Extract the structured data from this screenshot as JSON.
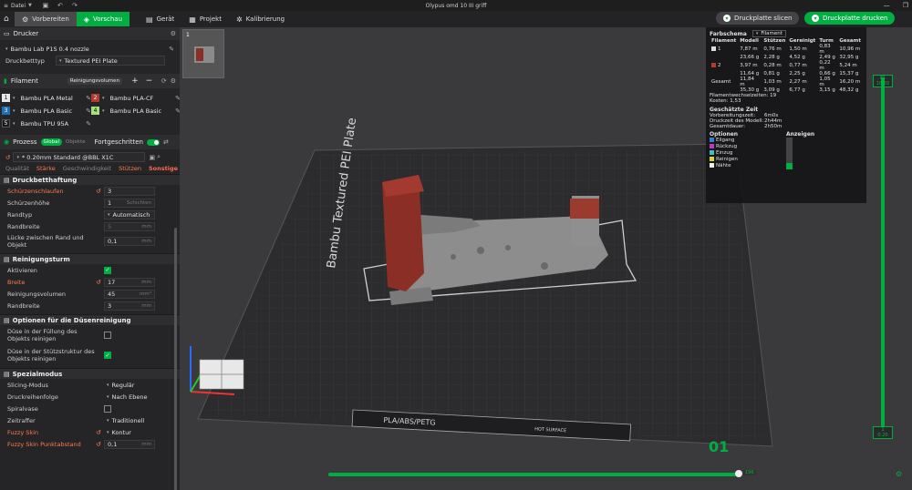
{
  "titlebar": {
    "menu": "Datei",
    "title": "Olypus omd 10 III griff"
  },
  "topbar": {
    "tabs": [
      {
        "label": "Vorbereiten"
      },
      {
        "label": "Vorschau"
      },
      {
        "label": "Gerät"
      },
      {
        "label": "Projekt"
      },
      {
        "label": "Kalibrierung"
      }
    ],
    "slice_button": "Druckplatte slicen",
    "print_button": "Druckplatte drucken"
  },
  "printer": {
    "section": "Drucker",
    "name": "Bambu Lab P1S 0.4 nozzle",
    "bed_label": "Druckbetttyp",
    "bed_value": "Textured PEI Plate"
  },
  "filament": {
    "section": "Filament",
    "clean_button": "Reinigungsvolumen",
    "items": [
      {
        "num": "1",
        "name": "Bambu PLA Metal",
        "color": "#e8e8e8"
      },
      {
        "num": "2",
        "name": "Bambu PLA-CF",
        "color": "#b23a2e"
      },
      {
        "num": "3",
        "name": "Bambu PLA Basic",
        "color": "#1f6fb2"
      },
      {
        "num": "4",
        "name": "Bambu PLA Basic",
        "color": "#a6e07a"
      },
      {
        "num": "5",
        "name": "Bambu TPU 95A",
        "color": "#1a1a1a"
      }
    ]
  },
  "process": {
    "section": "Prozess",
    "toggle_global": "Global",
    "toggle_objects": "Objekte",
    "advanced": "Fortgeschritten",
    "preset": "* 0.20mm Standard @BBL X1C",
    "tabs": [
      "Qualität",
      "Stärke",
      "Geschwindigkeit",
      "Stützen",
      "Sonstige"
    ]
  },
  "groups": [
    {
      "title": "Druckbetthaftung",
      "rows": [
        {
          "label": "Schürzenschlaufen",
          "value": "3",
          "unit": "",
          "orange": true
        },
        {
          "label": "Schürzenhöhe",
          "value": "1",
          "unit": "Schichten",
          "orange": false
        },
        {
          "label": "Randtyp",
          "value": "Automatisch",
          "unit": "",
          "orange": false,
          "drop": true
        },
        {
          "label": "Randbreite",
          "value": "5",
          "unit": "mm",
          "orange": false,
          "disabled": true
        },
        {
          "label": "Lücke zwischen Rand und Objekt",
          "value": "0,1",
          "unit": "mm",
          "orange": false
        }
      ]
    },
    {
      "title": "Reinigungsturm",
      "rows": [
        {
          "label": "Aktivieren",
          "check": true
        },
        {
          "label": "Breite",
          "value": "17",
          "unit": "mm",
          "orange": true
        },
        {
          "label": "Reinigungsvolumen",
          "value": "45",
          "unit": "mm³",
          "orange": false
        },
        {
          "label": "Randbreite",
          "value": "3",
          "unit": "mm",
          "orange": false
        }
      ]
    },
    {
      "title": "Optionen für die Düsenreinigung",
      "rows": [
        {
          "label": "Düse in der Füllung des Objekts reinigen",
          "check": false
        },
        {
          "label": "Düse in der Stützstruktur des Objekts reinigen",
          "check": true
        }
      ]
    },
    {
      "title": "Spezialmodus",
      "rows": [
        {
          "label": "Slicing-Modus",
          "value": "Regulär",
          "drop": true
        },
        {
          "label": "Druckreihenfolge",
          "value": "Nach Ebene",
          "drop": true
        },
        {
          "label": "Spiralvase",
          "check": false
        },
        {
          "label": "Zeitraffer",
          "value": "Traditionell",
          "drop": true
        },
        {
          "label": "Fuzzy Skin",
          "value": "Kontur",
          "drop": true,
          "orange": true
        },
        {
          "label": "Fuzzy Skin Punktabstand",
          "value": "0,1",
          "unit": "mm",
          "orange": true
        }
      ]
    }
  ],
  "stats": {
    "title": "Farbschema",
    "scheme": "Filament",
    "headers": [
      "Filament",
      "Modell",
      "Stützen",
      "Gereinigt",
      "Turm",
      "Gesamt"
    ],
    "rows": [
      {
        "id": "1",
        "color": "#dddddd",
        "l1": [
          "7,87 m",
          "0,76 m",
          "1,50 m",
          "0,83 m",
          "10,96 m"
        ],
        "l2": [
          "23,66 g",
          "2,28 g",
          "4,52 g",
          "2,49 g",
          "32,95 g"
        ]
      },
      {
        "id": "2",
        "color": "#b23a2e",
        "l1": [
          "3,97 m",
          "0,28 m",
          "0,77 m",
          "0,22 m",
          "5,24 m"
        ],
        "l2": [
          "11,64 g",
          "0,81 g",
          "2,25 g",
          "0,66 g",
          "15,37 g"
        ]
      }
    ],
    "total_label": "Gesamt",
    "total_l1": [
      "11,84 m",
      "1,03 m",
      "2,27 m",
      "1,05 m",
      "16,20 m"
    ],
    "total_l2": [
      "35,30 g",
      "3,09 g",
      "6,77 g",
      "3,15 g",
      "48,32 g"
    ],
    "changes": "Filamentwechselzeiten: 19",
    "cost": "Kosten: 1,53",
    "time_title": "Geschätzte Zeit",
    "time_rows": [
      {
        "label": "Vorbereitungszeit:",
        "value": "6m0s"
      },
      {
        "label": "Druckzeit des Modell:",
        "value": "2h44m"
      },
      {
        "label": "Gesamtdauer:",
        "value": "2h50m"
      }
    ],
    "opt_header": [
      "Optionen",
      "Anzeigen"
    ],
    "options": [
      {
        "name": "Eilgang",
        "color": "#3a7bd5"
      },
      {
        "name": "Rückzug",
        "color": "#c03ac0"
      },
      {
        "name": "Einzug",
        "color": "#3ac0c0"
      },
      {
        "name": "Reinigen",
        "color": "#d6d63a"
      },
      {
        "name": "Nähte",
        "color": "#eeeeee"
      }
    ]
  },
  "plate": {
    "label": "Bambu Textured PEI Plate",
    "material": "PLA/ABS/PETG",
    "hot": "HOT SURFACE",
    "number": "01"
  },
  "vslider": {
    "top_label": "0.2\n43.20",
    "bottom_label": "1\n0.20"
  }
}
